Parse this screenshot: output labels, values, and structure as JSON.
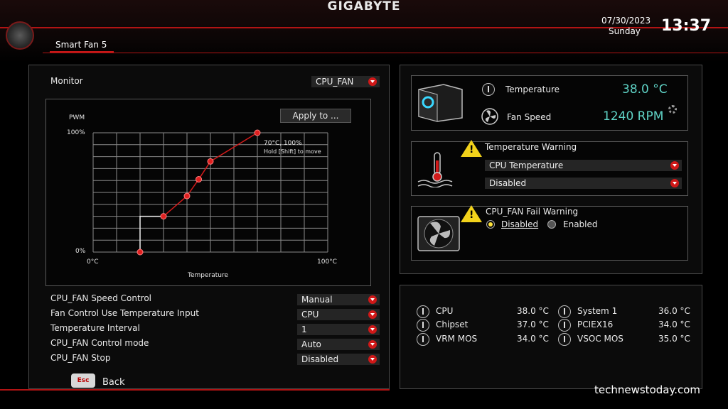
{
  "header": {
    "brand": "GIGABYTE",
    "tab": "Smart Fan 5",
    "date": "07/30/2023",
    "day": "Sunday",
    "time": "13:37"
  },
  "left": {
    "monitor_label": "Monitor",
    "monitor_value": "CPU_FAN",
    "apply_label": "Apply to ...",
    "chart": {
      "y_title": "PWM",
      "y_top": "100%",
      "y_bottom": "0%",
      "x_left": "0°C",
      "x_right": "100°C",
      "x_title": "Temperature",
      "tooltip_line1": "70°C, 100%",
      "tooltip_line2": "Hold [Shift] to move"
    },
    "settings": [
      {
        "label": "CPU_FAN Speed Control",
        "value": "Manual"
      },
      {
        "label": "Fan Control Use Temperature Input",
        "value": "CPU"
      },
      {
        "label": "Temperature Interval",
        "value": "1"
      },
      {
        "label": "CPU_FAN Control mode",
        "value": "Auto"
      },
      {
        "label": "CPU_FAN Stop",
        "value": "Disabled"
      }
    ]
  },
  "chart_data": {
    "type": "line",
    "title": "",
    "xlabel": "Temperature",
    "ylabel": "PWM",
    "xlim": [
      0,
      100
    ],
    "ylim": [
      0,
      100
    ],
    "x_tick_labels": [
      "0°C",
      "100°C"
    ],
    "y_tick_labels": [
      "0%",
      "100%"
    ],
    "grid": true,
    "series": [
      {
        "x": [
          20,
          30,
          40,
          45,
          50,
          70
        ],
        "y": [
          0,
          30,
          47,
          61,
          76,
          100
        ]
      }
    ]
  },
  "status": {
    "temperature_label": "Temperature",
    "temperature_value": "38.0 °C",
    "fanspeed_label": "Fan Speed",
    "fanspeed_value": "1240 RPM"
  },
  "temp_warning": {
    "title": "Temperature Warning",
    "source": "CPU Temperature",
    "value": "Disabled"
  },
  "fail_warning": {
    "title": "CPU_FAN Fail Warning",
    "opt_disabled": "Disabled",
    "opt_enabled": "Enabled"
  },
  "sensors": [
    {
      "name": "CPU",
      "value": "38.0 °C"
    },
    {
      "name": "System 1",
      "value": "36.0 °C"
    },
    {
      "name": "Chipset",
      "value": "37.0 °C"
    },
    {
      "name": "PCIEX16",
      "value": "34.0 °C"
    },
    {
      "name": "VRM MOS",
      "value": "34.0 °C"
    },
    {
      "name": "VSOC MOS",
      "value": "35.0 °C"
    }
  ],
  "footer": {
    "esc_key": "Esc",
    "back": "Back",
    "watermark": "technewstoday.com"
  },
  "colors": {
    "accent": "#c81818",
    "teal": "#5fd3c6",
    "warning": "#f2d21b"
  }
}
